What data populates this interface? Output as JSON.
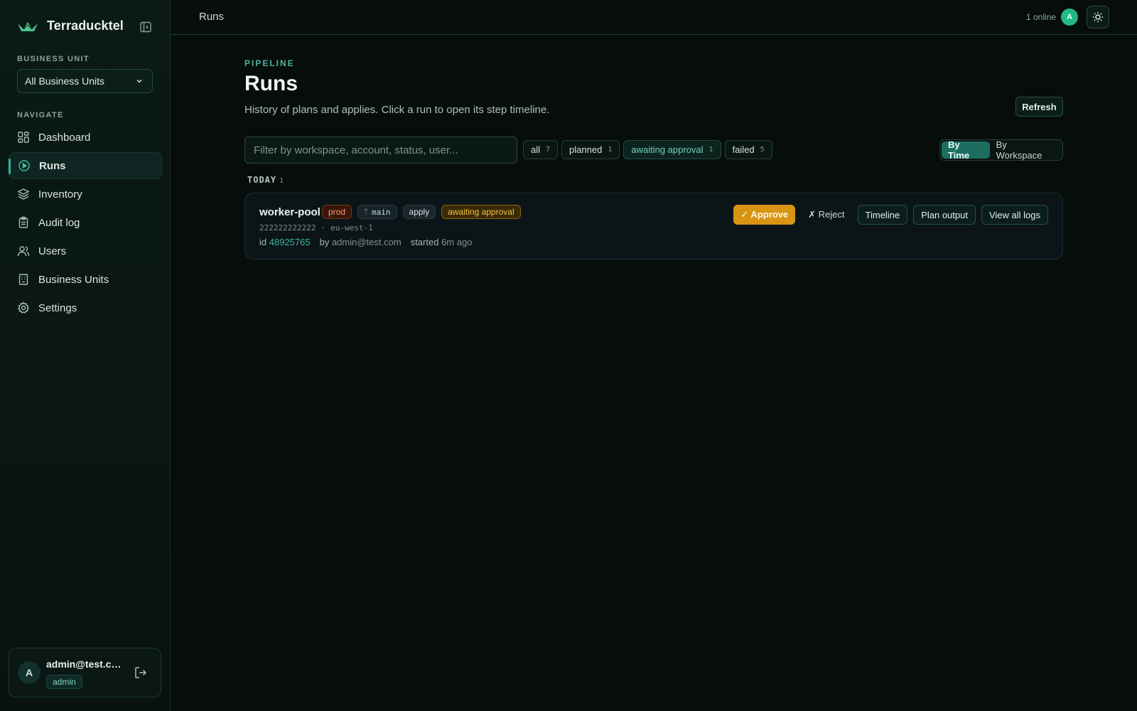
{
  "app": {
    "name": "Terraducktel"
  },
  "sidebar": {
    "business_unit_label": "BUSINESS UNIT",
    "business_unit_value": "All Business Units",
    "navigate_label": "NAVIGATE",
    "items": [
      {
        "label": "Dashboard",
        "icon": "dashboard-icon",
        "active": false
      },
      {
        "label": "Runs",
        "icon": "play-circle-icon",
        "active": true
      },
      {
        "label": "Inventory",
        "icon": "layers-icon",
        "active": false
      },
      {
        "label": "Audit log",
        "icon": "clipboard-icon",
        "active": false
      },
      {
        "label": "Users",
        "icon": "users-icon",
        "active": false
      },
      {
        "label": "Business Units",
        "icon": "building-icon",
        "active": false
      },
      {
        "label": "Settings",
        "icon": "gear-icon",
        "active": false
      }
    ],
    "user": {
      "initial": "A",
      "email": "admin@test.com",
      "role": "admin"
    }
  },
  "topbar": {
    "title": "Runs",
    "online_text": "1 online",
    "avatar_initial": "A"
  },
  "page": {
    "eyebrow": "PIPELINE",
    "title": "Runs",
    "subtitle": "History of plans and applies. Click a run to open its step timeline.",
    "refresh_label": "Refresh",
    "filter_placeholder": "Filter by workspace, account, status, user...",
    "filters": [
      {
        "label": "all",
        "count": "7"
      },
      {
        "label": "planned",
        "count": "1"
      },
      {
        "label": "awaiting approval",
        "count": "1"
      },
      {
        "label": "failed",
        "count": "5"
      }
    ],
    "view_toggle": {
      "by_time": "By Time",
      "by_workspace": "By Workspace",
      "selected": "By Time"
    },
    "group": {
      "label": "TODAY",
      "count": "1"
    },
    "runs": [
      {
        "workspace": "worker-pool",
        "environment": "prod",
        "branch": "main",
        "operation": "apply",
        "status": "awaiting approval",
        "account": "222222222222",
        "region": "eu-west-1",
        "id_label": "id",
        "id": "48925765",
        "by_label": "by",
        "user": "admin@test.com",
        "started_label": "started",
        "started": "6m ago",
        "actions": {
          "approve": "✓ Approve",
          "reject": "✗ Reject",
          "timeline": "Timeline",
          "plan_output": "Plan output",
          "view_logs": "View all logs"
        }
      }
    ]
  },
  "colors": {
    "accent": "#2bb59a",
    "approve": "#d99413",
    "status_awaiting": "#f3c14a",
    "env_prod": "#f2976c"
  }
}
